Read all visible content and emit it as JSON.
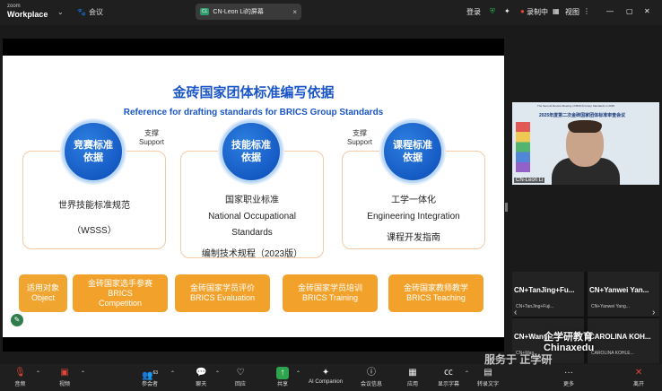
{
  "app": {
    "brand_line1": "zoom",
    "brand_line2": "Workplace",
    "meeting_label": "会议",
    "share_tab_badge": "CL",
    "share_tab_title": "CN-Leon Li的屏幕",
    "login": "登录",
    "recording": "录制中",
    "view": "视图"
  },
  "slide": {
    "title": "金砖国家团体标准编写依据",
    "subtitle": "Reference for drafting standards for BRICS Group Standards",
    "circle1": "竞赛标准\n依据",
    "circle2": "技能标准\n依据",
    "circle3": "课程标准\n依据",
    "support1_cn": "支撑",
    "support1_en": "Support",
    "support2_cn": "支撑",
    "support2_en": "Support",
    "col1_line1": "世界技能标准规范",
    "col1_line2": "（WSSS）",
    "col2_line1": "国家职业标准",
    "col2_line2": "National Occupational",
    "col2_line3": "Standards",
    "col2_line4": "编制技术规程（2023版）",
    "col3_line1": "工学一体化",
    "col3_line2": "Engineering Integration",
    "col3_line3": "课程开发指南",
    "buttons": [
      {
        "cn": "适用对象",
        "en": "Object"
      },
      {
        "cn": "金砖国家选手参赛",
        "en": "BRICS",
        "en2": "Competition"
      },
      {
        "cn": "金砖国家学员评价",
        "en": "BRICS Evaluation"
      },
      {
        "cn": "金砖国家学员培训",
        "en": "BRICS Training"
      },
      {
        "cn": "金砖国家教师教学",
        "en": "BRICS Teaching"
      }
    ]
  },
  "video": {
    "header1": "The Second Review Meeting of BRICS Group Standards in 2025",
    "header2": "2025年度第二次金砖国家团体标准审查会议",
    "name": "CN-Leon Li"
  },
  "participants": [
    {
      "big": "CN+TanJing+Fu...",
      "small": "CN+TanJing+Fuji..."
    },
    {
      "big": "CN+Yanwei  Yan...",
      "small": "CN+Yanwei Yang..."
    },
    {
      "big": "CN+Wang...",
      "small": "CN+Wan..."
    },
    {
      "big": "CAROLINA KOH...",
      "small": "CAROLINA KOHLE..."
    }
  ],
  "toolbar": [
    {
      "icon": "mic-off-icon",
      "label": "音频"
    },
    {
      "icon": "video-off-icon",
      "label": "视频"
    },
    {
      "icon": "participants-icon",
      "label": "参会者",
      "count": "63"
    },
    {
      "icon": "chat-icon",
      "label": "聊天"
    },
    {
      "icon": "react-icon",
      "label": "回应"
    },
    {
      "icon": "share-icon",
      "label": "共享"
    },
    {
      "icon": "ai-companion-icon",
      "label": "AI Companion"
    },
    {
      "icon": "meeting-info-icon",
      "label": "会议信息"
    },
    {
      "icon": "apps-icon",
      "label": "应用"
    },
    {
      "icon": "captions-icon",
      "label": "显示字幕"
    },
    {
      "icon": "translate-icon",
      "label": "转录文字"
    },
    {
      "icon": "more-icon",
      "label": "更多"
    },
    {
      "icon": "leave-icon",
      "label": "离开"
    }
  ],
  "watermark": {
    "line1": "服务于 正学研",
    "logo1": "企学研教育",
    "logo2": "Chinaxedu"
  },
  "colors": {
    "title_blue": "#1a55c8",
    "circle_blue": "#0b4bb8",
    "button_orange": "#f2a22a",
    "share_green": "#2ea44f",
    "leave_red": "#e0453a"
  }
}
